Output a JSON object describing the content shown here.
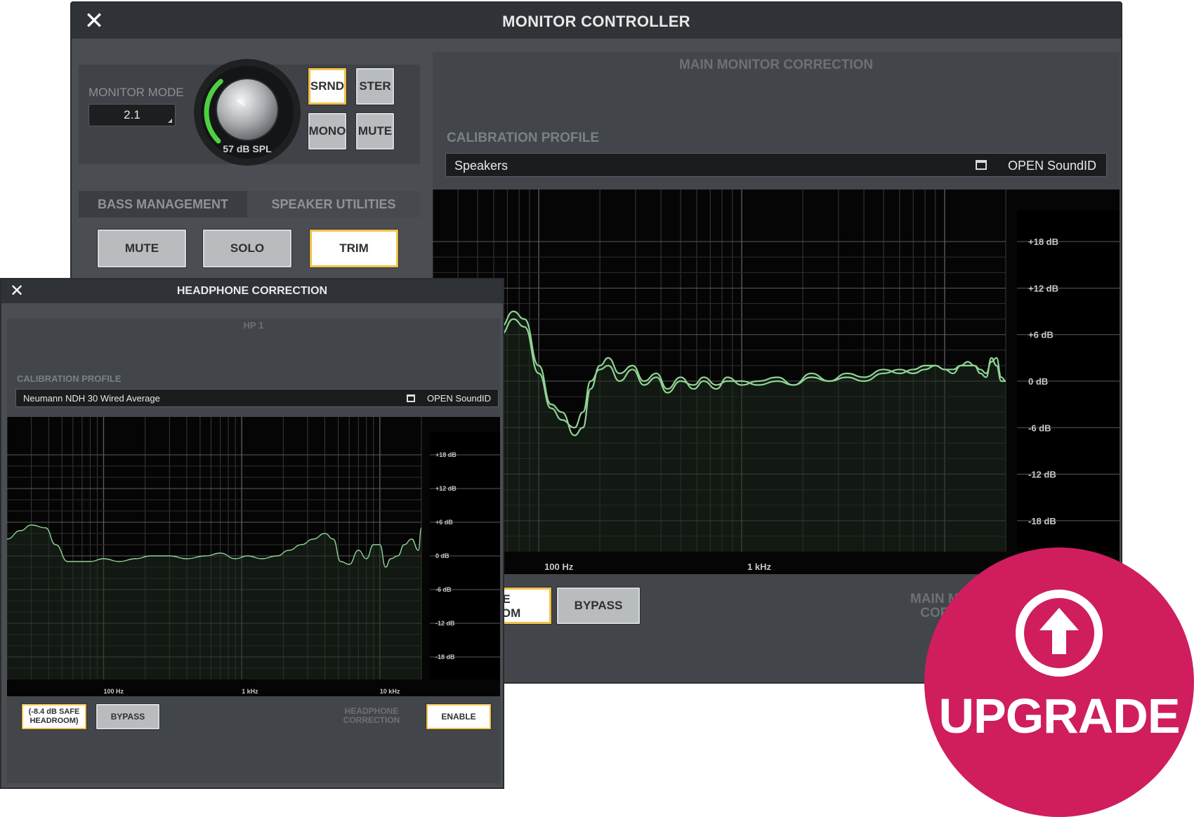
{
  "monitor_controller": {
    "title": "MONITOR CONTROLLER",
    "close_icon": "close-icon",
    "monitor_mode": {
      "label": "MONITOR MODE",
      "value": "2.1"
    },
    "knob": {
      "readout": "57 dB SPL",
      "level": 0.35
    },
    "mode_buttons": {
      "srnd": "SRND",
      "ster": "STER",
      "mono": "MONO",
      "mute": "MUTE"
    },
    "tabs": {
      "bass_management": "BASS MANAGEMENT",
      "speaker_utilities": "SPEAKER UTILITIES"
    },
    "utility_buttons": {
      "mute": "MUTE",
      "solo": "SOLO",
      "trim": "TRIM"
    },
    "main_monitor_correction": {
      "title": "MAIN MONITOR CORRECTION",
      "calibration_label": "CALIBRATION PROFILE",
      "calibration_value": "Speakers",
      "open_label": "OPEN SoundID",
      "headroom_btn_line1": "E",
      "headroom_btn_line2": "OOM",
      "bypass_label": "BYPASS",
      "footer_line1": "MAIN MO",
      "footer_line2": "CORR"
    }
  },
  "headphone_correction": {
    "title": "HEADPHONE CORRECTION",
    "subtitle": "HP 1",
    "calibration_label": "CALIBRATION PROFILE",
    "calibration_value": "Neumann NDH 30 Wired Average",
    "open_label": "OPEN SoundID",
    "headroom_line1": "(-8.4 dB SAFE",
    "headroom_line2": "HEADROOM)",
    "bypass_label": "BYPASS",
    "correction_line1": "HEADPHONE",
    "correction_line2": "CORRECTION",
    "enable_label": "ENABLE"
  },
  "upgrade": {
    "label": "UPGRADE",
    "icon": "upload-arrow-icon"
  },
  "colors": {
    "curve": "#8fd394",
    "curve_fill": "#1d2a1e",
    "accent_border": "#f0c04a",
    "badge": "#cf1d5e",
    "knob_ring": "#4cd040"
  },
  "chart_data": [
    {
      "type": "line",
      "xscale": "log",
      "xlim": [
        30,
        20000
      ],
      "ylim": [
        -22,
        22
      ],
      "x_ticks": [
        "100 Hz",
        "1 kHz"
      ],
      "y_ticks": [
        "+18 dB",
        "+12 dB",
        "+6 dB",
        "0 dB",
        "-6 dB",
        "-12 dB",
        "-18 dB"
      ],
      "series": [
        {
          "x": [
            30,
            40,
            50,
            58,
            65,
            75,
            85,
            100,
            115,
            130,
            150,
            165,
            180,
            200,
            220,
            250,
            290,
            330,
            380,
            430,
            500,
            580,
            650,
            750,
            850,
            1000,
            1200,
            1500,
            1800,
            2200,
            2700,
            3300,
            4000,
            5000,
            6000,
            7000,
            8000,
            9000,
            10000,
            11000,
            12000,
            13000,
            14000,
            15000,
            16000,
            17000,
            18000,
            19000,
            20000
          ],
          "y": [
            1,
            0.5,
            1.5,
            4,
            7,
            9,
            8,
            2,
            -3,
            -4,
            -7,
            -6,
            -1,
            2,
            3,
            1,
            2,
            0,
            1,
            -1,
            0.5,
            -1,
            0,
            -1,
            0.5,
            -0.5,
            0,
            0.5,
            -0.5,
            1,
            0,
            1,
            0.5,
            1.5,
            1,
            1.5,
            2,
            2,
            1.5,
            1,
            2,
            2.5,
            2,
            1,
            0.5,
            3,
            2,
            0,
            0
          ]
        },
        {
          "x": [
            30,
            40,
            50,
            58,
            65,
            75,
            85,
            100,
            115,
            130,
            150,
            165,
            180,
            200,
            220,
            250,
            290,
            330,
            380,
            430,
            500,
            580,
            650,
            750,
            850,
            1000,
            1200,
            1500,
            1800,
            2200,
            2700,
            3300,
            4000,
            5000,
            6000,
            7000,
            8000,
            9000,
            10000,
            11000,
            12000,
            13000,
            14000,
            15000,
            16000,
            17000,
            18000,
            19000,
            20000
          ],
          "y": [
            1,
            0.5,
            1.5,
            3.5,
            6,
            8,
            7,
            1,
            -3.5,
            -5,
            -6,
            -4,
            0,
            1.5,
            2,
            0,
            1.5,
            -0.5,
            0.5,
            -1.5,
            0,
            -0.5,
            0.5,
            -0.5,
            0,
            0,
            -0.5,
            0,
            -0.5,
            0.5,
            0,
            0.5,
            0,
            1,
            1.5,
            1,
            1.5,
            2,
            1.5,
            1.5,
            2,
            2,
            2,
            1.5,
            1,
            2.5,
            3,
            0.5,
            0
          ]
        }
      ]
    },
    {
      "type": "line",
      "xscale": "log",
      "xlim": [
        20,
        20000
      ],
      "ylim": [
        -22,
        22
      ],
      "x_ticks": [
        "100 Hz",
        "1 kHz",
        "10 kHz"
      ],
      "y_ticks": [
        "+18 dB",
        "+12 dB",
        "+6 dB",
        "0 dB",
        "-6 dB",
        "-12 dB",
        "-18 dB"
      ],
      "series": [
        {
          "x": [
            20,
            25,
            30,
            38,
            45,
            55,
            65,
            80,
            100,
            130,
            170,
            220,
            300,
            400,
            550,
            700,
            900,
            1100,
            1400,
            1800,
            2200,
            2700,
            3300,
            4000,
            4600,
            5200,
            6000,
            7000,
            8000,
            9000,
            10000,
            11000,
            12000,
            13500,
            15000,
            17000,
            19000,
            20000
          ],
          "y": [
            3,
            4.5,
            5.5,
            5,
            2,
            -1,
            -1,
            -1,
            -0.5,
            -1,
            -0.5,
            0,
            0,
            -0.5,
            0,
            0.5,
            -0.5,
            0,
            -0.5,
            0,
            1,
            2,
            3,
            4,
            3,
            -1,
            -1.5,
            1,
            -0.5,
            2,
            2,
            -2,
            -0.5,
            0,
            2,
            3,
            1,
            5
          ]
        }
      ]
    }
  ]
}
